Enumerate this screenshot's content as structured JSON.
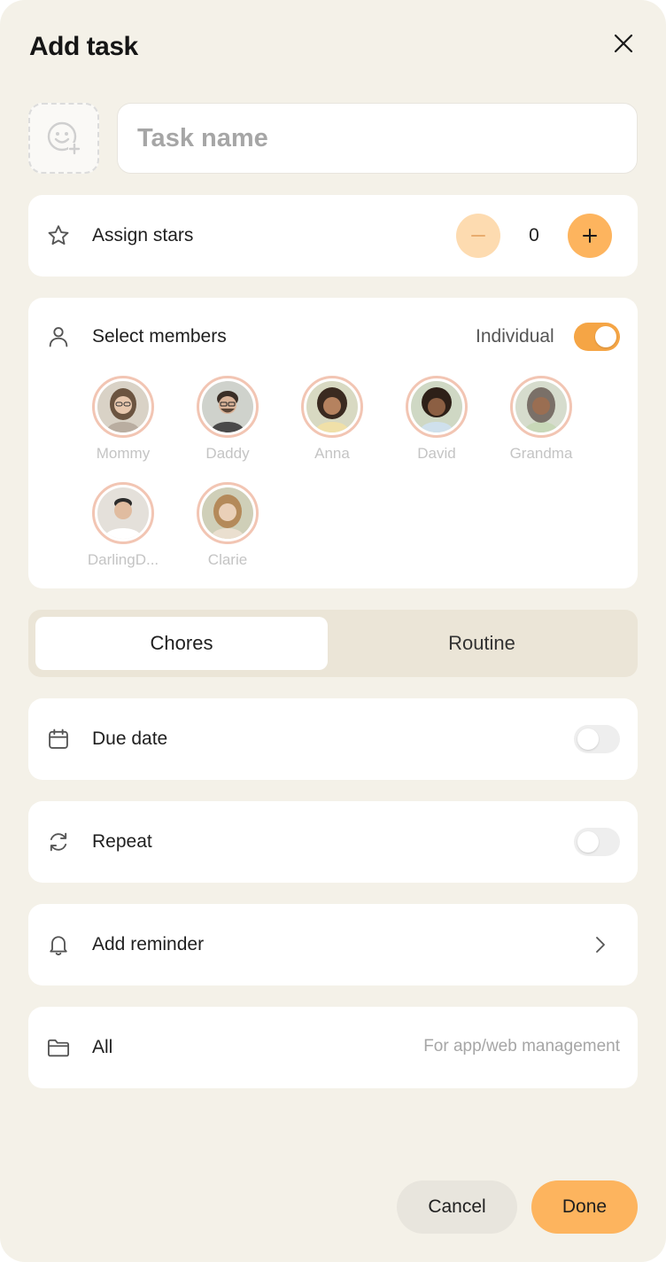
{
  "dialog": {
    "title": "Add task"
  },
  "task": {
    "name_placeholder": "Task name",
    "name_value": ""
  },
  "stars": {
    "label": "Assign stars",
    "count": "0"
  },
  "members": {
    "label": "Select members",
    "mode_label": "Individual",
    "mode_on": true,
    "list": [
      {
        "name": "Mommy"
      },
      {
        "name": "Daddy"
      },
      {
        "name": "Anna"
      },
      {
        "name": "David"
      },
      {
        "name": "Grandma"
      },
      {
        "name": "DarlingD..."
      },
      {
        "name": "Clarie"
      }
    ]
  },
  "segments": {
    "chores": "Chores",
    "routine": "Routine",
    "selected": "Chores"
  },
  "due_date": {
    "label": "Due date",
    "on": false
  },
  "repeat": {
    "label": "Repeat",
    "on": false
  },
  "reminder": {
    "label": "Add reminder"
  },
  "folder": {
    "label": "All",
    "hint": "For app/web management"
  },
  "actions": {
    "cancel": "Cancel",
    "done": "Done"
  },
  "colors": {
    "background": "#f4f1e8",
    "accent": "#fdb45e",
    "accent_light": "#fddbb0",
    "toggle_on": "#f5a545",
    "avatar_ring": "#f2c5b3"
  }
}
